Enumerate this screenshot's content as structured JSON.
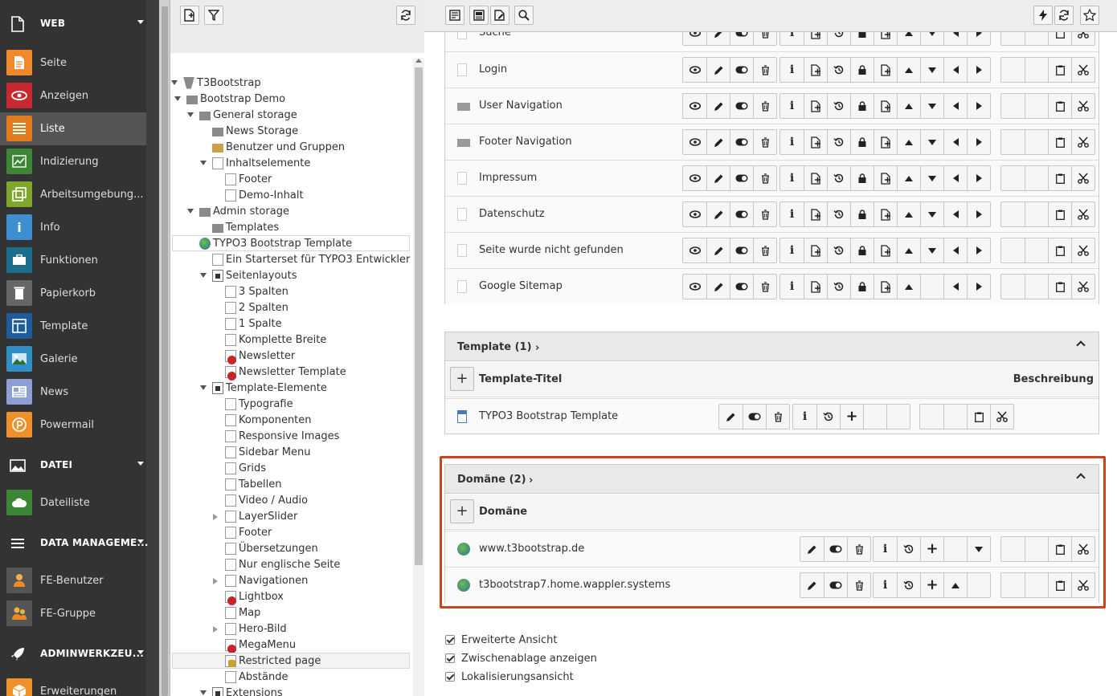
{
  "module_menu": {
    "groups": [
      {
        "label": "WEB",
        "icon": "page-icon"
      },
      {
        "label": "DATEI",
        "icon": "image-icon"
      },
      {
        "label": "DATA MANAGEME...",
        "icon": "hamburger-icon"
      },
      {
        "label": "ADMINWERKZEU...",
        "icon": "rocket-icon"
      }
    ],
    "web_items": [
      {
        "label": "Seite",
        "icon": "page-icon",
        "color": "#f0882d"
      },
      {
        "label": "Anzeigen",
        "icon": "eye-icon",
        "color": "#c8282f"
      },
      {
        "label": "Liste",
        "icon": "list-icon",
        "color": "#e07b1e"
      },
      {
        "label": "Indizierung",
        "icon": "chart-icon",
        "color": "#3c8638"
      },
      {
        "label": "Arbeitsumgebung...",
        "icon": "workspace-icon",
        "color": "#80a62c"
      },
      {
        "label": "Info",
        "icon": "info-icon",
        "color": "#3d8fd1"
      },
      {
        "label": "Funktionen",
        "icon": "briefcase-icon",
        "color": "#1c6f8c"
      },
      {
        "label": "Papierkorb",
        "icon": "trash-icon",
        "color": "#666666"
      },
      {
        "label": "Template",
        "icon": "template-icon",
        "color": "#1e5d9c"
      },
      {
        "label": "Galerie",
        "icon": "gallery-icon",
        "color": "#2e8fc9"
      },
      {
        "label": "News",
        "icon": "news-icon",
        "color": "#8e9fd5"
      },
      {
        "label": "Powermail",
        "icon": "powermail-icon",
        "color": "#f0902a"
      }
    ],
    "datei_items": [
      {
        "label": "Dateiliste",
        "icon": "cloud-icon",
        "color": "#3c8638"
      }
    ],
    "data_items": [
      {
        "label": "FE-Benutzer",
        "icon": "user-icon",
        "color": "#555555"
      },
      {
        "label": "FE-Gruppe",
        "icon": "group-icon",
        "color": "#555555"
      }
    ],
    "admin_items": [
      {
        "label": "Erweiterungen",
        "icon": "box-icon",
        "color": "#f0902a"
      }
    ],
    "active": "Liste"
  },
  "tree": {
    "nodes": [
      {
        "label": "T3Bootstrap",
        "icon": "root"
      },
      {
        "label": "Bootstrap Demo",
        "icon": "folder"
      },
      {
        "label": "General storage",
        "icon": "folder"
      },
      {
        "label": "News Storage",
        "icon": "folder"
      },
      {
        "label": "Benutzer und Gruppen",
        "icon": "sysf"
      },
      {
        "label": "Inhaltselemente",
        "icon": "page"
      },
      {
        "label": "Footer",
        "icon": "page"
      },
      {
        "label": "Demo-Inhalt",
        "icon": "page"
      },
      {
        "label": "Admin storage",
        "icon": "folder"
      },
      {
        "label": "Templates",
        "icon": "folder"
      },
      {
        "label": "TYPO3 Bootstrap Template",
        "icon": "world"
      },
      {
        "label": "Ein Starterset für TYPO3 Entwickler",
        "icon": "page"
      },
      {
        "label": "Seitenlayouts",
        "icon": "shortcut"
      },
      {
        "label": "3 Spalten",
        "icon": "page"
      },
      {
        "label": "2 Spalten",
        "icon": "page"
      },
      {
        "label": "1 Spalte",
        "icon": "page"
      },
      {
        "label": "Komplette Breite",
        "icon": "page"
      },
      {
        "label": "Newsletter",
        "icon": "noaccess"
      },
      {
        "label": "Newsletter Template",
        "icon": "noaccess"
      },
      {
        "label": "Template-Elemente",
        "icon": "shortcut"
      },
      {
        "label": "Typografie",
        "icon": "page"
      },
      {
        "label": "Komponenten",
        "icon": "page"
      },
      {
        "label": "Responsive Images",
        "icon": "page"
      },
      {
        "label": "Sidebar Menu",
        "icon": "page"
      },
      {
        "label": "Grids",
        "icon": "page"
      },
      {
        "label": "Tabellen",
        "icon": "page"
      },
      {
        "label": "Video / Audio",
        "icon": "page"
      },
      {
        "label": "LayerSlider",
        "icon": "page"
      },
      {
        "label": "Footer",
        "icon": "page"
      },
      {
        "label": "Übersetzungen",
        "icon": "page"
      },
      {
        "label": "Nur englische Seite",
        "icon": "page"
      },
      {
        "label": "Navigationen",
        "icon": "page"
      },
      {
        "label": "Lightbox",
        "icon": "noaccess"
      },
      {
        "label": "Map",
        "icon": "page"
      },
      {
        "label": "Hero-Bild",
        "icon": "page"
      },
      {
        "label": "MegaMenu",
        "icon": "noaccess"
      },
      {
        "label": "Restricted page",
        "icon": "restricted"
      },
      {
        "label": "Abstände",
        "icon": "page"
      },
      {
        "label": "Extensions",
        "icon": "shortcut"
      }
    ]
  },
  "pages_table": {
    "rows": [
      {
        "label": "Suche",
        "icon": "page"
      },
      {
        "label": "Login",
        "icon": "page"
      },
      {
        "label": "User Navigation",
        "icon": "folder"
      },
      {
        "label": "Footer Navigation",
        "icon": "folder"
      },
      {
        "label": "Impressum",
        "icon": "page"
      },
      {
        "label": "Datenschutz",
        "icon": "page"
      },
      {
        "label": "Seite wurde nicht gefunden",
        "icon": "page"
      },
      {
        "label": "Google Sitemap",
        "icon": "page"
      }
    ]
  },
  "template_panel": {
    "title": "Template (1)",
    "col_title": "Template-Titel",
    "col_desc": "Beschreibung",
    "rows": [
      {
        "label": "TYPO3 Bootstrap Template"
      }
    ]
  },
  "domain_panel": {
    "title": "Domäne (2)",
    "col_title": "Domäne",
    "rows": [
      {
        "label": "www.t3bootstrap.de"
      },
      {
        "label": "t3bootstrap7.home.wappler.systems"
      }
    ],
    "highlight_color": "#d0401a"
  },
  "options": [
    {
      "label": "Erweiterte Ansicht",
      "checked": true
    },
    {
      "label": "Zwischenablage anzeigen",
      "checked": true
    },
    {
      "label": "Lokalisierungsansicht",
      "checked": true
    }
  ]
}
